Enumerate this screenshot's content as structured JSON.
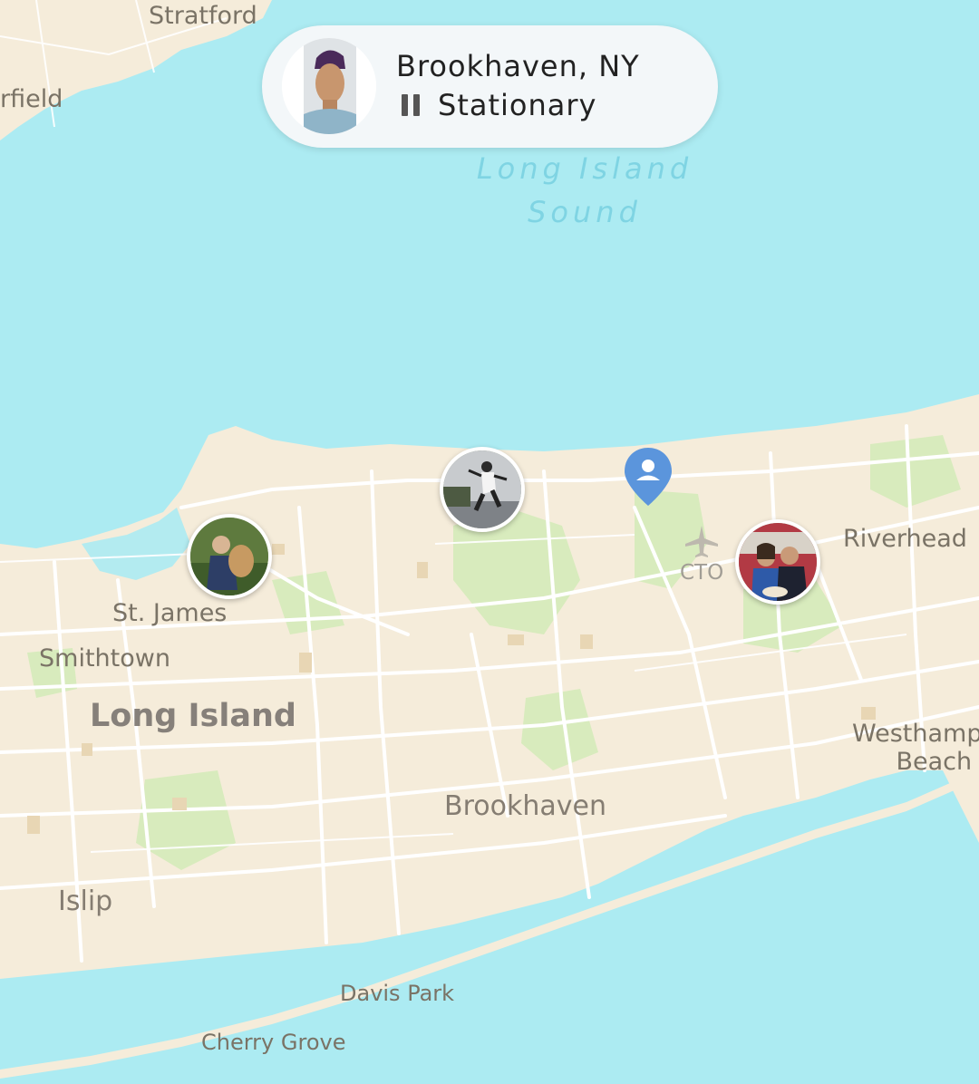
{
  "status_card": {
    "location": "Brookhaven, NY",
    "status": "Stationary"
  },
  "places": {
    "stratford": "Stratford",
    "fairfield": "rfield",
    "sound_line1": "Long Island",
    "sound_line2": "Sound",
    "st_james": "St. James",
    "smithtown": "Smithtown",
    "long_island": "Long Island",
    "riverhead": "Riverhead",
    "cto": "CTO",
    "westhampton_line1": "Westhampto",
    "westhampton_line2": "Beach",
    "brookhaven": "Brookhaven",
    "islip": "Islip",
    "davis_park": "Davis Park",
    "cherry_grove": "Cherry Grove"
  },
  "friends": [
    {
      "name": "friend-avatar-st-james"
    },
    {
      "name": "friend-avatar-north-shore"
    },
    {
      "name": "friend-avatar-riverhead"
    }
  ],
  "colors": {
    "water": "#acebf2",
    "land": "#f5ecda",
    "park": "#d8ebbd",
    "road": "#ffffff",
    "pin": "#5b95dc"
  }
}
